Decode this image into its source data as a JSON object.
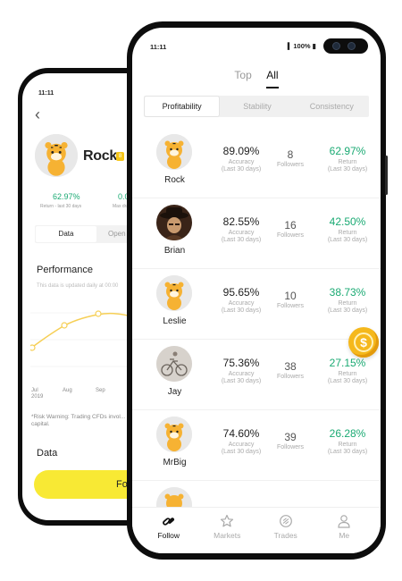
{
  "back_screen": {
    "time": "11:11",
    "trader_name": "Rock",
    "return_value": "62.97%",
    "return_label": "Return - last 30 days",
    "drawdown_value": "0.0",
    "drawdown_label": "Max drawdown",
    "drawdown_label_cont": "day",
    "tabs": [
      "Data",
      "Open t"
    ],
    "performance_title": "Performance",
    "performance_note": "This data is updated daily at 00:00",
    "x_labels": [
      "Jul\n2019",
      "Aug",
      "Sep",
      "Oc"
    ],
    "risk_warning": "*Risk Warning: Trading CFDs invol... of your capital.",
    "data_title": "Data",
    "follow_button": "Follo"
  },
  "front_screen": {
    "time": "11:11",
    "battery": "100%",
    "top_tabs": [
      {
        "label": "Top",
        "active": false
      },
      {
        "label": "All",
        "active": true
      }
    ],
    "segments": [
      {
        "label": "Profitability",
        "active": true
      },
      {
        "label": "Stability",
        "active": false
      },
      {
        "label": "Consistency",
        "active": false
      }
    ],
    "accuracy_label": "Accuracy",
    "period_label": "(Last 30 days)",
    "followers_label": "Followers",
    "return_label": "Return",
    "traders": [
      {
        "name": "Rock",
        "accuracy": "89.09%",
        "followers": "8",
        "return": "62.97%",
        "avatar": "tiger"
      },
      {
        "name": "Brian",
        "accuracy": "82.55%",
        "followers": "16",
        "return": "42.50%",
        "avatar": "hat-man"
      },
      {
        "name": "Leslie",
        "accuracy": "95.65%",
        "followers": "10",
        "return": "38.73%",
        "avatar": "tiger"
      },
      {
        "name": "Jay",
        "accuracy": "75.36%",
        "followers": "38",
        "return": "27.15%",
        "avatar": "bicycle"
      },
      {
        "name": "MrBig",
        "accuracy": "74.60%",
        "followers": "39",
        "return": "26.28%",
        "avatar": "tiger"
      }
    ],
    "bottom_nav": [
      {
        "label": "Follow",
        "icon": "follow-link-icon",
        "active": true
      },
      {
        "label": "Markets",
        "icon": "star-icon",
        "active": false
      },
      {
        "label": "Trades",
        "icon": "trades-circle-icon",
        "active": false
      },
      {
        "label": "Me",
        "icon": "person-icon",
        "active": false
      }
    ],
    "colors": {
      "positive": "#1aaa73",
      "accent_yellow": "#f8e934",
      "coin": "#f5b81c"
    }
  }
}
